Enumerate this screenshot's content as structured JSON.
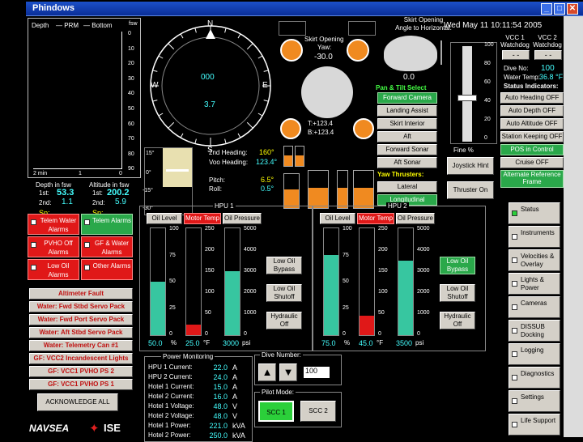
{
  "window": {
    "title": "Phindows",
    "controls": [
      "_",
      "□",
      "✕"
    ]
  },
  "depth": {
    "title": "Depth",
    "legend_prm": "PRM",
    "legend_bottom": "Bottom",
    "unit": "fsw",
    "yticks": [
      "0",
      "10",
      "20",
      "30",
      "40",
      "50",
      "60",
      "70",
      "80",
      "90"
    ],
    "xticks": [
      "2 min",
      "1",
      "0"
    ],
    "depth_label": "Depth in fsw",
    "depth_1st_label": "1st:",
    "depth_1st": "53.3",
    "depth_2nd_label": "2nd:",
    "depth_2nd": "1.1",
    "depth_sp_label": "Sp:",
    "alt_label": "Altitude in fsw",
    "alt_1st_label": "1st:",
    "alt_1st": "200.2",
    "alt_2nd_label": "2nd:",
    "alt_2nd": "5.9",
    "alt_sp_label": "Sp:"
  },
  "compass": {
    "heading": "000",
    "N": "N",
    "E": "E",
    "S": "S",
    "W": "W",
    "value": "3.7"
  },
  "skirt": {
    "yaw_label1": "Skirt Opening",
    "yaw_label2": "Yaw:",
    "yaw_value": "-30.0",
    "angle_label1": "Skirt Opening",
    "angle_label2": "Angle to Horizontal:",
    "angle_value": "0.0",
    "pos_t": "T:+123.4",
    "pos_b": "B:+123.4"
  },
  "heading": {
    "pitch_ticks": [
      "15°",
      "0°",
      "-15°",
      "-30°"
    ],
    "h2_label": "2nd Heading:",
    "h2_value": "160°",
    "voo_label": "Voo Heading:",
    "voo_value": "123.4°",
    "pitch_label": "Pitch:",
    "pitch_value": "6.5°",
    "roll_label": "Roll:",
    "roll_value": "0.5°"
  },
  "datetime": "Wed May 11 10:11:54 2005",
  "watchdog": {
    "vcc1_label": "VCC 1 Watchdog",
    "vcc1_value": "- -",
    "vcc2_label": "VCC 2 Watchdog",
    "vcc2_value": "- -",
    "dive_label": "Dive No:",
    "dive_value": "100",
    "temp_label": "Water Temp:",
    "temp_value": "36.8 °F"
  },
  "fine": {
    "ticks": [
      "100",
      "80",
      "60",
      "40",
      "20",
      "0"
    ],
    "label": "Fine %"
  },
  "pan_tilt": {
    "title": "Pan & Tilt Select",
    "items": [
      "Forward Camera",
      "Landing Assist",
      "Skirt Interior",
      "Aft",
      "Forward Sonar",
      "Aft Sonar"
    ]
  },
  "yaw_thrusters": {
    "title": "Yaw Thrusters:",
    "items": [
      "Lateral",
      "Longitudinal"
    ]
  },
  "joystick": {
    "hint": "Joystick Hint",
    "thruster": "Thruster On"
  },
  "status": {
    "title": "Status Indicators:",
    "items": [
      "Auto Heading OFF",
      "Auto Depth OFF",
      "Auto Altitude OFF",
      "Station Keeping OFF",
      "POS in Control",
      "Cruise OFF",
      "Alternate Reference Frame"
    ]
  },
  "alarms": {
    "grid": [
      "Telem Water Alarms",
      "Telem Alarms",
      "PVHO Off Alarms",
      "GF & Water Alarms",
      "Low Oil Alarms",
      "Other Alarms"
    ],
    "list": [
      "Altimeter Fault",
      "Water: Fwd Stbd Servo Pack",
      "Water: Fwd Port Servo Pack",
      "Water: Aft Stbd Servo Pack",
      "Water: Telemetry Can #1",
      "GF: VCC2 Incandescent Lights",
      "GF: VCC1 PVHO PS 2",
      "GF: VCC1 PVHO PS 1"
    ],
    "ack": "ACKNOWLEDGE ALL"
  },
  "hpu1": {
    "title": "HPU 1",
    "oil_level": "Oil Level",
    "motor_temp": "Motor Temp",
    "oil_pressure": "Oil Pressure",
    "ticks_level": [
      "100",
      "75",
      "50",
      "25",
      "0"
    ],
    "ticks_temp": [
      "250",
      "200",
      "150",
      "100",
      "50",
      "0"
    ],
    "ticks_press": [
      "5000",
      "4000",
      "3000",
      "2000",
      "1000",
      "0"
    ],
    "v_level": "50.0",
    "u_level": "%",
    "v_temp": "25.0",
    "u_temp": "°F",
    "v_press": "3000",
    "u_press": "psi",
    "btn1": "Low Oil Bypass",
    "btn2": "Low Oil Shutoff",
    "btn3": "Hydraulic Off",
    "level_frac": 0.5,
    "temp_frac": 0.1,
    "press_frac": 0.6
  },
  "hpu2": {
    "title": "HPU 2",
    "oil_level": "Oil Level",
    "motor_temp": "Motor Temp",
    "oil_pressure": "Oil Pressure",
    "ticks_level": [
      "100",
      "75",
      "50",
      "25",
      "0"
    ],
    "ticks_temp": [
      "250",
      "200",
      "150",
      "100",
      "50",
      "0"
    ],
    "ticks_press": [
      "5000",
      "4000",
      "3000",
      "2000",
      "1000",
      "0"
    ],
    "v_level": "75.0",
    "u_level": "%",
    "v_temp": "45.0",
    "u_temp": "°F",
    "v_press": "3500",
    "u_press": "psi",
    "btn1": "Low Oil Bypass",
    "btn2": "Low Oil Shutoff",
    "btn3": "Hydraulic Off",
    "level_frac": 0.75,
    "temp_frac": 0.18,
    "press_frac": 0.7
  },
  "power": {
    "title": "Power Monitoring",
    "rows": [
      {
        "label": "HPU 1 Current:",
        "value": "22.0",
        "unit": "A"
      },
      {
        "label": "HPU 2 Current:",
        "value": "24.0",
        "unit": "A"
      },
      {
        "label": "Hotel 1 Current:",
        "value": "15.0",
        "unit": "A"
      },
      {
        "label": "Hotel 2 Current:",
        "value": "16.0",
        "unit": "A"
      },
      {
        "label": "Hotel 1 Voltage:",
        "value": "48.0",
        "unit": "V"
      },
      {
        "label": "Hotel 2 Voltage:",
        "value": "48.0",
        "unit": "V"
      },
      {
        "label": "Hotel 1 Power:",
        "value": "221.0",
        "unit": "kVA"
      },
      {
        "label": "Hotel 2 Power:",
        "value": "250.0",
        "unit": "kVA"
      }
    ]
  },
  "dive_number": {
    "title": "Dive Number:",
    "value": "100"
  },
  "pilot_mode": {
    "title": "Pilot Mode:",
    "scc1": "SCC 1",
    "scc2": "SCC 2"
  },
  "nav": {
    "items": [
      "Status",
      "Instruments",
      "Velocities & Overlay",
      "Lights & Power",
      "Cameras",
      "DISSUB Docking",
      "Logging",
      "Diagnostics",
      "Settings",
      "Life Support"
    ]
  },
  "logos": {
    "navsea": "NAVSEA",
    "ise": "ISE"
  }
}
